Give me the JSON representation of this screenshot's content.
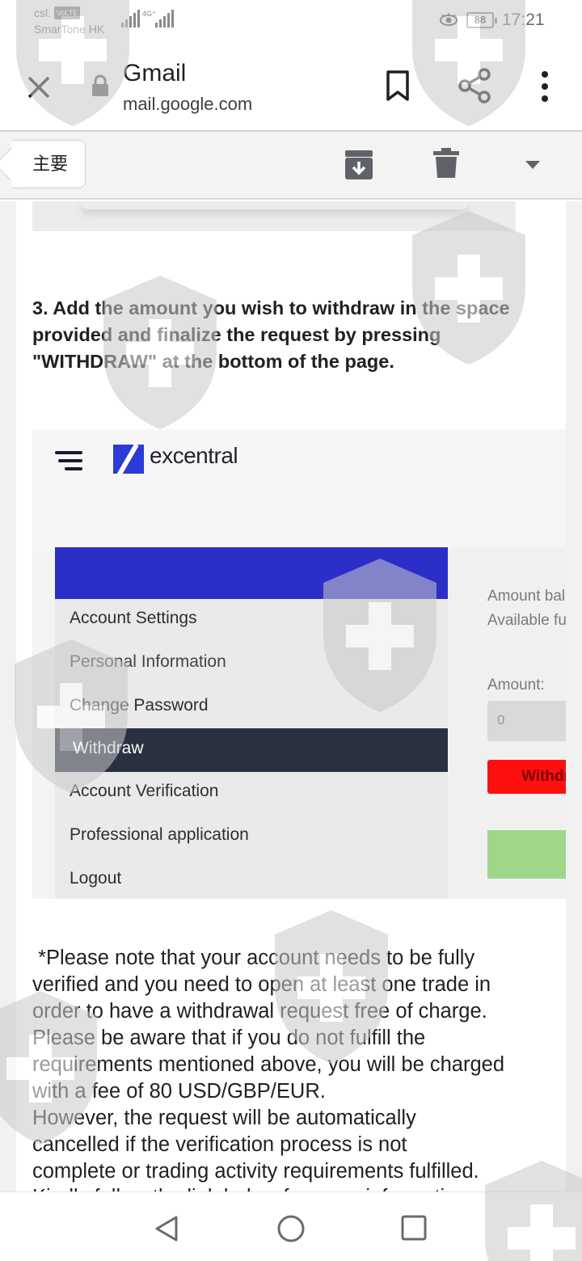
{
  "status_bar": {
    "carrier_top": "csl.",
    "volte": "VoLTE",
    "carrier_name": "SmarTone HK",
    "network": "4G⁺",
    "battery": "88",
    "time": "17:21"
  },
  "browser": {
    "title": "Gmail",
    "url": "mail.google.com"
  },
  "gmail_toolbar": {
    "back_label": "主要"
  },
  "email": {
    "step_text": "3. Add the amount you wish to withdraw in the space provided and finalize the request by pressing \"WITHDRAW\" at the bottom of the page.",
    "embedded": {
      "brand": "excentral",
      "menu": [
        "Account Settings",
        "Personal Information",
        "Change Password",
        "Withdraw",
        "Account Verification",
        "Professional application",
        "Logout"
      ],
      "active_item": "Withdraw",
      "amount_balance": "Amount bal",
      "available_funds": "Available fu",
      "amount_label": "Amount:",
      "amount_value": "0",
      "withdraw_button": "Withdra"
    },
    "note_lines": [
      " *Please note that your account needs to be fully",
      "verified and you need to open at least one trade in",
      "order to have a withdrawal request free of charge.",
      "Please be aware that if you do not fulfill the",
      "requirements mentioned above, you will be charged",
      "with a fee of 80 USD/GBP/EUR.",
      "However, the request will be automatically",
      "cancelled if the verification process is not",
      "complete or trading activity requirements fulfilled."
    ],
    "note_cut": "Kindly follow the link below for more information"
  },
  "colors": {
    "brand_blue": "#2b2fc7",
    "active_menu": "#2a3040",
    "withdraw_red": "#ff1010",
    "green_button": "#9fd68a"
  },
  "icons": [
    "close-icon",
    "lock-icon",
    "bookmark-icon",
    "share-icon",
    "more-icon",
    "archive-icon",
    "trash-icon",
    "dropdown-icon",
    "nav-back-icon",
    "nav-home-icon",
    "nav-recent-icon"
  ]
}
